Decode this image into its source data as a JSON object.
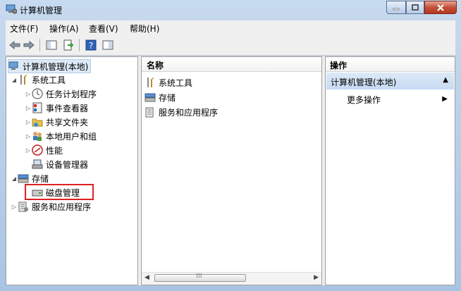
{
  "window": {
    "title": "计算机管理"
  },
  "menu": [
    {
      "label": "文件(F)",
      "name": "menu-file"
    },
    {
      "label": "操作(A)",
      "name": "menu-action"
    },
    {
      "label": "查看(V)",
      "name": "menu-view"
    },
    {
      "label": "帮助(H)",
      "name": "menu-help"
    }
  ],
  "tree": {
    "root": "计算机管理(本地)",
    "system_tools": "系统工具",
    "task_scheduler": "任务计划程序",
    "event_viewer": "事件查看器",
    "shared_folders": "共享文件夹",
    "local_users": "本地用户和组",
    "performance": "性能",
    "device_manager": "设备管理器",
    "storage": "存储",
    "disk_management": "磁盘管理",
    "services": "服务和应用程序"
  },
  "list": {
    "column_name": "名称",
    "items": [
      "系统工具",
      "存储",
      "服务和应用程序"
    ]
  },
  "actions": {
    "header": "操作",
    "group": "计算机管理(本地)",
    "more": "更多操作"
  },
  "colors": {
    "highlight": "#e02020",
    "action_group": "#c6daf2"
  }
}
